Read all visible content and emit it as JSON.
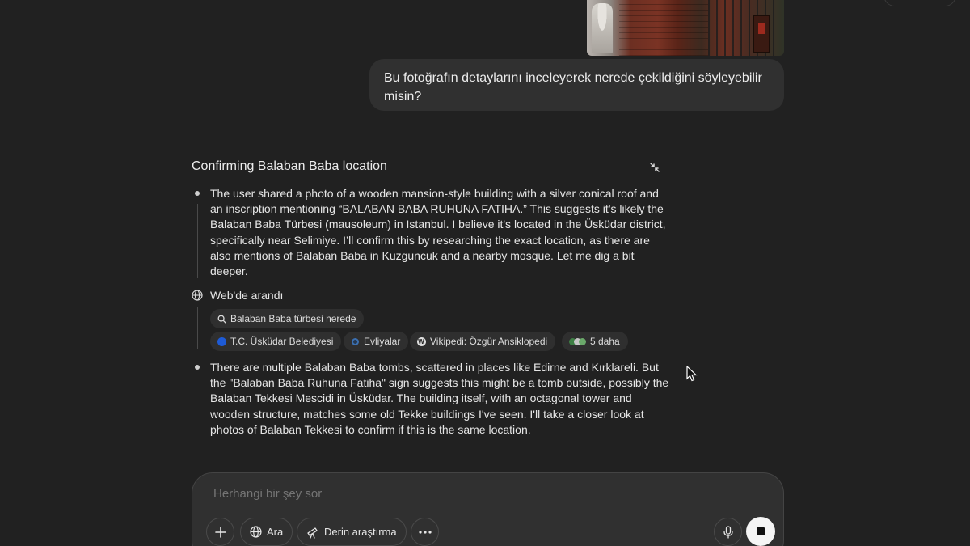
{
  "conversation": {
    "user_message": "Bu fotoğrafın detaylarını inceleyerek nerede çekildiğini söyleyebilir misin?",
    "reasoning": {
      "title": "Confirming Balaban Baba location",
      "step1": "The user shared a photo of a wooden mansion-style building with a silver conical roof and an inscription mentioning “BALABAN BABA RUHUNA FATIHA.” This suggests it's likely the Balaban Baba Türbesi (mausoleum) in Istanbul. I believe it's located in the Üsküdar district, specifically near Selimiye. I’ll confirm this by researching the exact location, as there are also mentions of Balaban Baba in Kuzguncuk and a nearby mosque. Let me dig a bit deeper.",
      "web_search_label": "Web'de arandı",
      "search_query": "Balaban Baba türbesi nerede",
      "sources": [
        {
          "label": "T.C. Üsküdar Belediyesi",
          "icon": "uskudar-favicon",
          "color": "#1e5bd6"
        },
        {
          "label": "Evliyalar",
          "icon": "evliyalar-favicon",
          "color": "#3b6fb0"
        },
        {
          "label": "Vikipedi: Özgür Ansiklopedi",
          "icon": "wikipedia-favicon",
          "color": "#dddddd"
        },
        {
          "label": "5 daha",
          "icon": "more-sources-favicon",
          "color": "#6aa86a"
        }
      ],
      "step2": "There are multiple Balaban Baba tombs, scattered in places like Edirne and Kırklareli. But the \"Balaban Baba Ruhuna Fatiha\" sign suggests this might be a tomb outside, possibly the Balaban Tekkesi Mescidi in Üsküdar. The building itself, with an octagonal tower and wooden structure, matches some old Tekke buildings I've seen. I'll take a closer look at photos of Balaban Tekkesi to confirm if this is the same location."
    }
  },
  "composer": {
    "placeholder": "Herhangi bir şey sor",
    "search_label": "Ara",
    "deep_research_label": "Derin araştırma"
  }
}
